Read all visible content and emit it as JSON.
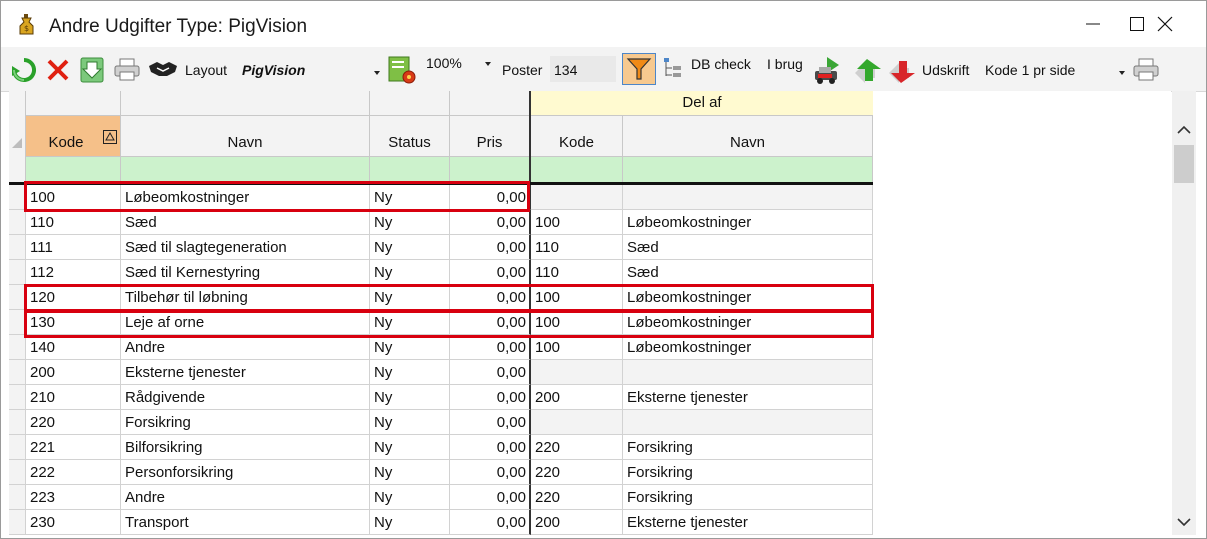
{
  "window": {
    "title": "Andre Udgifter Type: PigVision"
  },
  "toolbar": {
    "layout_label": "Layout",
    "layout_value": "PigVision",
    "zoom_value": "100%",
    "poster_label": "Poster",
    "poster_value": "134",
    "db_check_label": "DB check",
    "i_brug_label": "I brug",
    "udskrift_label": "Udskrift",
    "print_mode_value": "Kode 1 pr side"
  },
  "grid": {
    "group_header": "Del af",
    "columns": [
      "Kode",
      "Navn",
      "Status",
      "Pris",
      "Kode",
      "Navn"
    ],
    "rows": [
      {
        "kode": "100",
        "navn": "Løbeomkostninger",
        "status": "Ny",
        "pris": "0,00",
        "del_kode": "",
        "del_navn": ""
      },
      {
        "kode": "110",
        "navn": "Sæd",
        "status": "Ny",
        "pris": "0,00",
        "del_kode": "100",
        "del_navn": "Løbeomkostninger"
      },
      {
        "kode": "111",
        "navn": "Sæd til slagtegeneration",
        "status": "Ny",
        "pris": "0,00",
        "del_kode": "110",
        "del_navn": "Sæd"
      },
      {
        "kode": "112",
        "navn": "Sæd til Kernestyring",
        "status": "Ny",
        "pris": "0,00",
        "del_kode": "110",
        "del_navn": "Sæd"
      },
      {
        "kode": "120",
        "navn": "Tilbehør til løbning",
        "status": "Ny",
        "pris": "0,00",
        "del_kode": "100",
        "del_navn": "Løbeomkostninger"
      },
      {
        "kode": "130",
        "navn": "Leje af orne",
        "status": "Ny",
        "pris": "0,00",
        "del_kode": "100",
        "del_navn": "Løbeomkostninger"
      },
      {
        "kode": "140",
        "navn": "Andre",
        "status": "Ny",
        "pris": "0,00",
        "del_kode": "100",
        "del_navn": "Løbeomkostninger"
      },
      {
        "kode": "200",
        "navn": "Eksterne tjenester",
        "status": "Ny",
        "pris": "0,00",
        "del_kode": "",
        "del_navn": ""
      },
      {
        "kode": "210",
        "navn": "Rådgivende",
        "status": "Ny",
        "pris": "0,00",
        "del_kode": "200",
        "del_navn": "Eksterne tjenester"
      },
      {
        "kode": "220",
        "navn": "Forsikring",
        "status": "Ny",
        "pris": "0,00",
        "del_kode": "",
        "del_navn": ""
      },
      {
        "kode": "221",
        "navn": "Bilforsikring",
        "status": "Ny",
        "pris": "0,00",
        "del_kode": "220",
        "del_navn": "Forsikring"
      },
      {
        "kode": "222",
        "navn": "Personforsikring",
        "status": "Ny",
        "pris": "0,00",
        "del_kode": "220",
        "del_navn": "Forsikring"
      },
      {
        "kode": "223",
        "navn": "Andre",
        "status": "Ny",
        "pris": "0,00",
        "del_kode": "220",
        "del_navn": "Forsikring"
      },
      {
        "kode": "230",
        "navn": "Transport",
        "status": "Ny",
        "pris": "0,00",
        "del_kode": "200",
        "del_navn": "Eksterne tjenester"
      }
    ]
  },
  "colors": {
    "highlight": "#d8000f",
    "sort_header": "#f5c089",
    "group_header": "#fffad0",
    "filter_row": "#ccf2cc"
  }
}
